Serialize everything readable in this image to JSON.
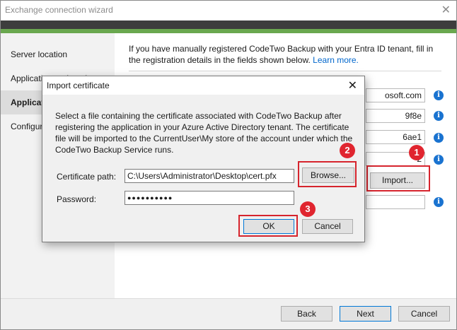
{
  "window": {
    "title": "Exchange connection wizard",
    "close_glyph": "✕"
  },
  "sidebar": {
    "items": [
      {
        "label": "Server location"
      },
      {
        "label": "Application registration"
      },
      {
        "label": "Application details"
      },
      {
        "label": "Configuration"
      }
    ]
  },
  "content": {
    "intro_text": "If you have manually registered CodeTwo Backup with your Entra ID tenant, fill in the registration details in the fields shown below.",
    "learn_more": "Learn more.",
    "fields": [
      {
        "value": "osoft.com"
      },
      {
        "value": "9f8e"
      },
      {
        "value": "6ae1"
      },
      {
        "value": "2"
      },
      {
        "value": ""
      }
    ],
    "info_glyph": "i",
    "import_label": "Import..."
  },
  "footer": {
    "back_label": "Back",
    "next_label": "Next",
    "cancel_label": "Cancel"
  },
  "dialog": {
    "title": "Import certificate",
    "close_glyph": "✕",
    "description": "Select a file containing the certificate associated with CodeTwo Backup after registering the application in your Azure Active Directory tenant. The certificate file will be imported to the CurrentUser\\My store of the account under which the CodeTwo Backup Service runs.",
    "cert_path_label": "Certificate path:",
    "cert_path_value": "C:\\Users\\Administrator\\Desktop\\cert.pfx",
    "browse_label": "Browse...",
    "password_label": "Password:",
    "password_value": "●●●●●●●●●●",
    "ok_label": "OK",
    "cancel_label": "Cancel"
  },
  "annotations": {
    "badges": [
      "1",
      "2",
      "3"
    ],
    "color": "#d6242d"
  }
}
